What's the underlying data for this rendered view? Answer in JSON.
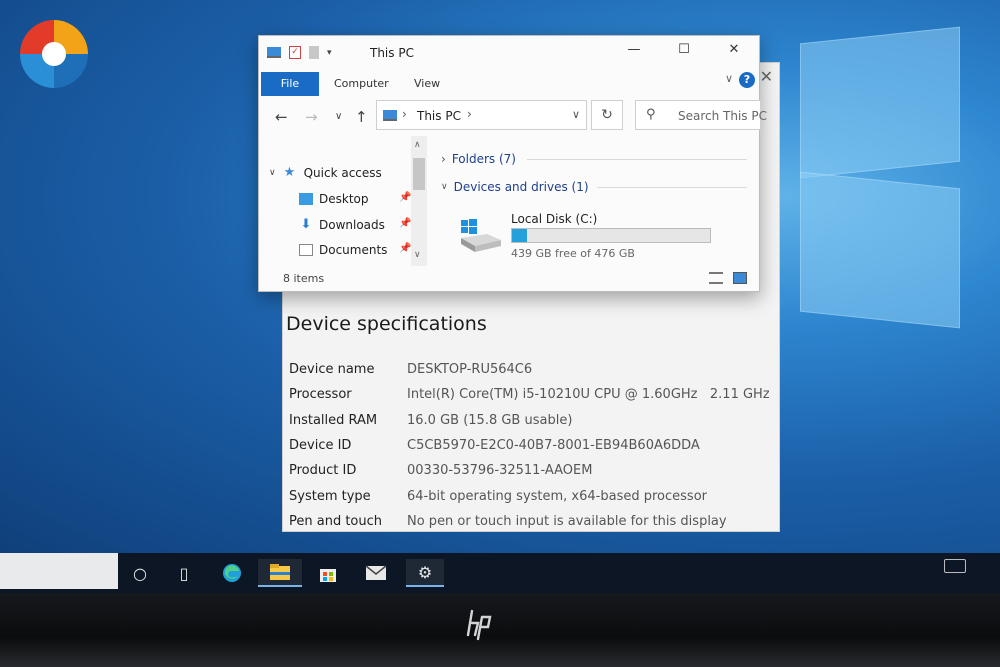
{
  "explorer": {
    "title": "This PC",
    "tabs": [
      "File",
      "Computer",
      "View"
    ],
    "address": {
      "location": "This PC"
    },
    "search_placeholder": "Search This PC",
    "nav": [
      {
        "label": "Quick access",
        "icon": "star-icon"
      },
      {
        "label": "Desktop",
        "icon": "desktop-folder-icon",
        "pinned": true
      },
      {
        "label": "Downloads",
        "icon": "download-arrow-icon",
        "pinned": true
      },
      {
        "label": "Documents",
        "icon": "documents-icon",
        "pinned": true
      }
    ],
    "groups": [
      {
        "label": "Folders (7)",
        "expanded": false
      },
      {
        "label": "Devices and drives (1)",
        "expanded": true
      }
    ],
    "drive": {
      "name": "Local Disk (C:)",
      "free_text": "439 GB free of 476 GB",
      "used_fraction": 0.078
    },
    "status": "8 items"
  },
  "about": {
    "section_title": "Device specifications",
    "specs": [
      {
        "label": "Device name",
        "value": "DESKTOP-RU564C6"
      },
      {
        "label": "Processor",
        "value": "Intel(R) Core(TM) i5-10210U CPU @ 1.60GHz   2.11 GHz"
      },
      {
        "label": "Installed RAM",
        "value": "16.0 GB (15.8 GB usable)"
      },
      {
        "label": "Device ID",
        "value": "C5CB5970-E2C0-40B7-8001-EB94B60A6DDA"
      },
      {
        "label": "Product ID",
        "value": "00330-53796-32511-AAOEM"
      },
      {
        "label": "System type",
        "value": "64-bit operating system, x64-based processor"
      },
      {
        "label": "Pen and touch",
        "value": "No pen or touch input is available for this display"
      }
    ]
  },
  "taskbar": {
    "icons": [
      "cortana-circle-icon",
      "task-view-icon",
      "edge-icon",
      "file-explorer-icon",
      "store-icon",
      "mail-icon",
      "settings-gear-icon"
    ]
  },
  "colors": {
    "accent": "#1a6bc4",
    "drive_fill": "#26a0da",
    "desktop_blue": "#1b5fa8"
  }
}
